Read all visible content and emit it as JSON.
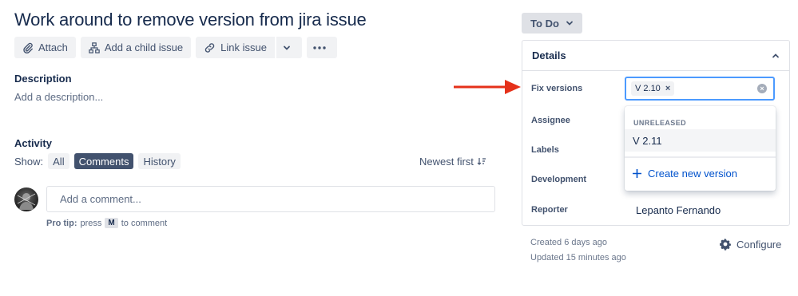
{
  "issue": {
    "title": "Work around to remove version from jira issue"
  },
  "toolbar": {
    "attach": "Attach",
    "add_child": "Add a child issue",
    "link_issue": "Link issue"
  },
  "description": {
    "label": "Description",
    "placeholder": "Add a description..."
  },
  "activity": {
    "label": "Activity",
    "show_label": "Show:",
    "filters": [
      "All",
      "Comments",
      "History"
    ],
    "active_filter": "Comments",
    "sort": "Newest first"
  },
  "comment": {
    "placeholder": "Add a comment...",
    "protip_prefix": "Pro tip:",
    "protip_mid": "press",
    "protip_key": "M",
    "protip_suffix": "to comment"
  },
  "status": {
    "label": "To Do"
  },
  "details": {
    "heading": "Details",
    "fields": {
      "fix_versions": "Fix versions",
      "assignee": "Assignee",
      "labels": "Labels",
      "development": "Development",
      "reporter": "Reporter"
    },
    "reporter_value": "Lepanto Fernando",
    "fix_version_tag": "V 2.10"
  },
  "dropdown": {
    "group": "UNRELEASED",
    "option": "V 2.11",
    "create": "Create new version"
  },
  "meta": {
    "created": "Created 6 days ago",
    "updated": "Updated 15 minutes ago",
    "configure": "Configure"
  },
  "colors": {
    "accent": "#0052cc",
    "annotation_arrow": "#e5311a",
    "focus": "#4c9aff"
  }
}
